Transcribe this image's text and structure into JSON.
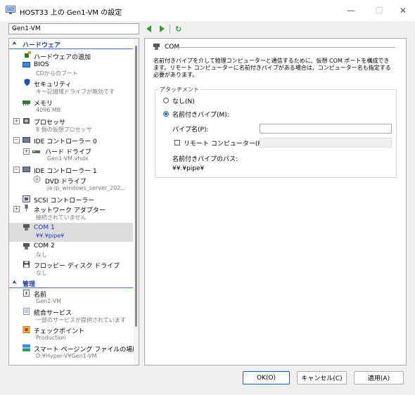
{
  "window": {
    "title": "HOST33 上の Gen1-VM の設定",
    "vm_selector": "Gen1-VM"
  },
  "sections": {
    "hardware": "ハードウェア",
    "management": "管理"
  },
  "hardware_items": [
    {
      "label": "ハードウェアの追加",
      "sub": ""
    },
    {
      "label": "BIOS",
      "sub": "CDからのブート"
    },
    {
      "label": "セキュリティ",
      "sub": "キー記憶域ドライブが無効です"
    },
    {
      "label": "メモリ",
      "sub": "4096 MB"
    },
    {
      "label": "プロセッサ",
      "sub": "8 個の仮想プロセッサ"
    },
    {
      "label": "IDE コントローラー 0",
      "sub": ""
    },
    {
      "label": "ハード ドライブ",
      "sub": "Gen1-VM.vhdx"
    },
    {
      "label": "IDE コントローラー 1",
      "sub": ""
    },
    {
      "label": "DVD ドライブ",
      "sub": "ja-jp_windows_server_202..."
    },
    {
      "label": "SCSI コントローラー",
      "sub": ""
    },
    {
      "label": "ネットワーク アダプター",
      "sub": "接続されていません"
    },
    {
      "label": "COM 1",
      "sub": "¥¥.¥pipe¥"
    },
    {
      "label": "COM 2",
      "sub": "なし"
    },
    {
      "label": "フロッピー ディスク ドライブ",
      "sub": "なし"
    }
  ],
  "management_items": [
    {
      "label": "名前",
      "sub": "Gen1-VM"
    },
    {
      "label": "統合サービス",
      "sub": "一部のサービスが提供されています"
    },
    {
      "label": "チェックポイント",
      "sub": "Production"
    },
    {
      "label": "スマート ページング ファイルの場所",
      "sub": "D:¥Hyper-V¥Gen1-VM"
    }
  ],
  "com_panel": {
    "title": "COM",
    "description": "名前付きパイプを介して物理コンピューターと通信するために、仮想 COM ポートを構成できます。リモート コンピューターに名前付きパイプがある場合は、コンピューター名も指定する必要があります。",
    "attachment_label": "アタッチメント",
    "option_none": "なし(N)",
    "option_named_pipe": "名前付きパイプ(M):",
    "pipe_name_label": "パイプ名(P):",
    "pipe_name_value": "",
    "remote_computer_label": "リモート コンピューター(R):",
    "remote_computer_value": "",
    "pipe_path_label": "名前付きパイプのパス:",
    "pipe_path_value": "¥¥.¥pipe¥"
  },
  "buttons": {
    "ok": "OK(O)",
    "cancel": "キャンセル(C)",
    "apply": "適用(A)"
  },
  "colors": {
    "accent": "#1a3fbf",
    "selection": "#dcdcdc",
    "nav_green": "#2f9e2f"
  }
}
